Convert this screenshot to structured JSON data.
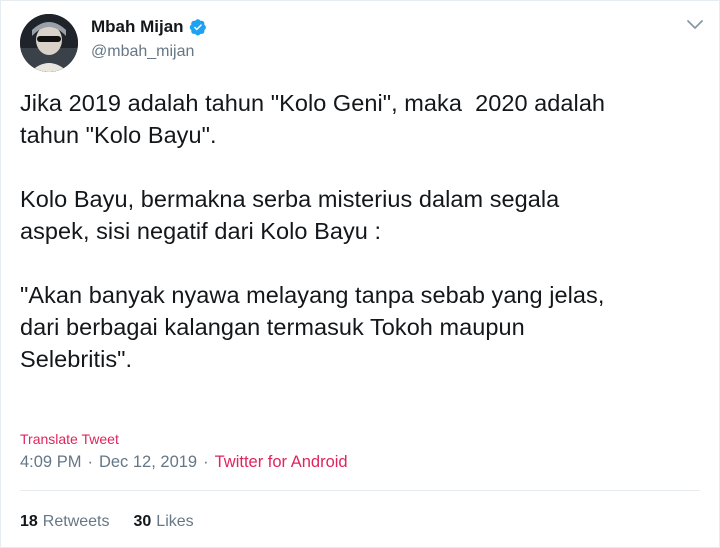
{
  "user": {
    "display_name": "Mbah Mijan",
    "handle": "@mbah_mijan",
    "verified": true
  },
  "tweet": {
    "text": "Jika 2019 adalah tahun \"Kolo Geni\", maka  2020 adalah\ntahun \"Kolo Bayu\".\n\nKolo Bayu, bermakna serba misterius dalam segala\naspek, sisi negatif dari Kolo Bayu :\n\n\"Akan banyak nyawa melayang tanpa sebab yang jelas,\ndari berbagai kalangan termasuk Tokoh maupun\nSelebritis\".",
    "translate_label": "Translate Tweet",
    "time": "4:09 PM",
    "date": "Dec 12, 2019",
    "separator": "·",
    "source": "Twitter for Android"
  },
  "stats": {
    "retweets_count": "18",
    "retweets_label": "Retweets",
    "likes_count": "30",
    "likes_label": "Likes"
  },
  "colors": {
    "accent": "#e0245e",
    "verified": "#1da1f2",
    "muted": "#657786",
    "text": "#14171a"
  },
  "icons": {
    "avatar": "avatar-image",
    "verified": "verified-badge-icon",
    "menu": "chevron-down-icon"
  }
}
